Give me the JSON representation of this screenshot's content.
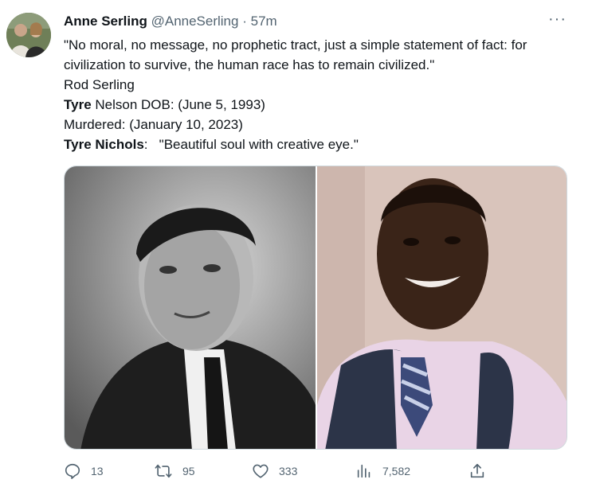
{
  "author": {
    "name": "Anne Serling",
    "handle": "@AnneSerling",
    "separator": "·",
    "time": "57m"
  },
  "more_label": "···",
  "body": {
    "quote": "\"No moral, no message, no prophetic tract, just a simple statement of fact: for civilization to survive, the human race has to remain civilized.\"",
    "attribution": "Rod Serling",
    "line3_bold": "Tyre",
    "line3_rest": " Nelson DOB: (June 5, 1993)",
    "line4": "Murdered: (January 10, 2023)",
    "line5_bold": "Tyre Nichols",
    "line5_rest": ":   \"Beautiful soul with creative eye.\""
  },
  "media": {
    "left_icon": "portrait-photo-bw",
    "right_icon": "portrait-photo-color"
  },
  "actions": {
    "reply": {
      "icon": "reply-icon",
      "count": "13"
    },
    "retweet": {
      "icon": "retweet-icon",
      "count": "95"
    },
    "like": {
      "icon": "heart-icon",
      "count": "333"
    },
    "views": {
      "icon": "views-icon",
      "count": "7,582"
    },
    "share": {
      "icon": "share-icon"
    }
  }
}
